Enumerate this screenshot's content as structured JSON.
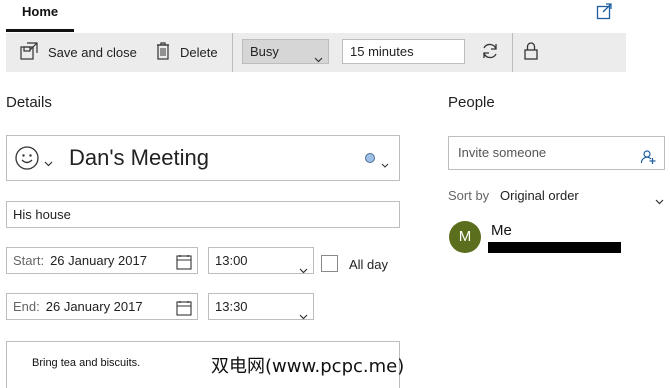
{
  "tabs": {
    "home": "Home"
  },
  "toolbar": {
    "save_close_label": "Save and close",
    "delete_label": "Delete",
    "show_as_value": "Busy",
    "reminder_value": "15 minutes"
  },
  "details": {
    "heading": "Details",
    "title": "Dan's Meeting",
    "location": "His house",
    "start_label": "Start:",
    "start_date": "26 January 2017",
    "start_time": "13:00",
    "end_label": "End:",
    "end_date": "26 January 2017",
    "end_time": "13:30",
    "all_day_label": "All day",
    "all_day_checked": false,
    "notes": "Bring tea and biscuits.",
    "category_color": "#9ec1e8"
  },
  "people": {
    "heading": "People",
    "invite_placeholder": "Invite someone",
    "sort_label": "Sort by",
    "sort_value": "Original order",
    "attendees": [
      {
        "initial": "M",
        "name": "Me",
        "avatar_color": "#5b6e1e"
      }
    ]
  },
  "watermark": "双电网(www.pcpc.me)",
  "icons": [
    "popout-icon",
    "save-close-icon",
    "delete-icon",
    "chevron-down-icon",
    "repeat-icon",
    "lock-icon",
    "emoji-icon",
    "calendar-icon",
    "add-person-icon"
  ]
}
